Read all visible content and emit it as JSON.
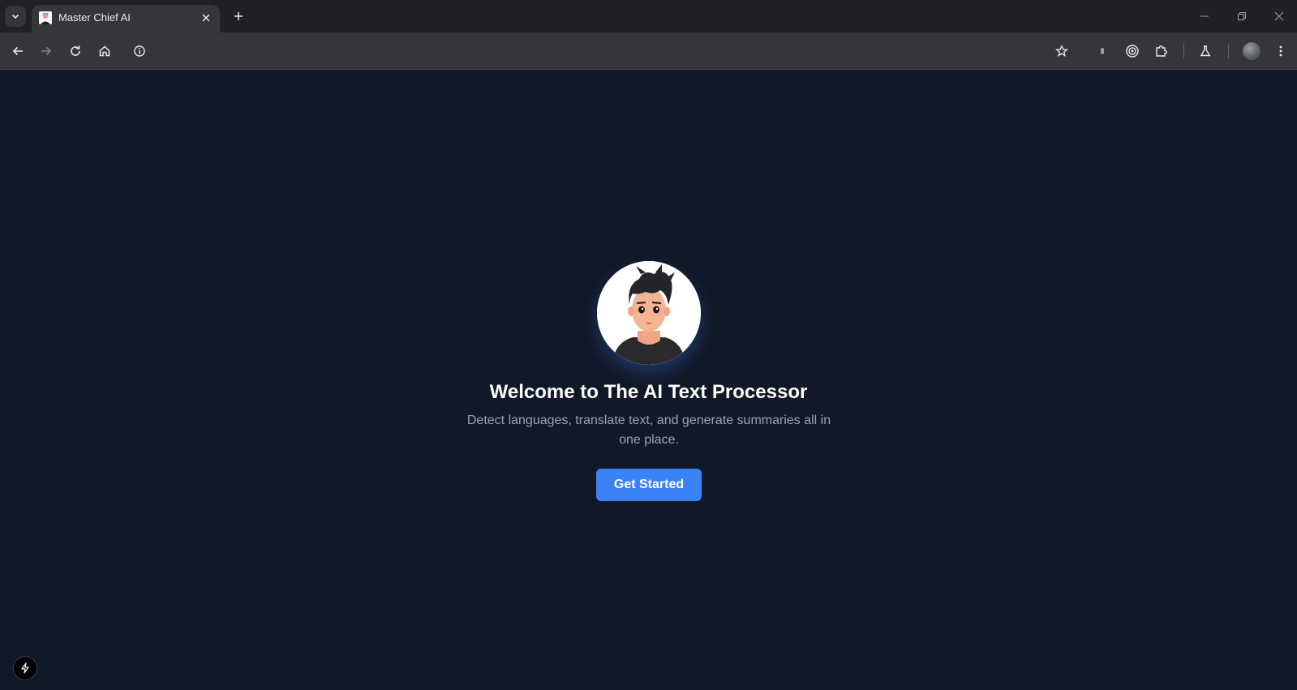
{
  "browser": {
    "tab": {
      "title": "Master Chief AI"
    },
    "icons": {
      "tab_search": "chevron-down-icon",
      "close_tab": "close-icon",
      "new_tab": "plus-icon",
      "back": "arrow-left-icon",
      "forward": "arrow-right-icon",
      "reload": "reload-icon",
      "home": "home-icon",
      "site_info": "info-icon",
      "bookmark": "star-icon",
      "extensions": "puzzle-icon",
      "labs": "flask-icon",
      "menu": "kebab-menu-icon"
    }
  },
  "page": {
    "title": "Welcome to The AI Text Processor",
    "subtitle": "Detect languages, translate text, and generate summaries all in one place.",
    "cta_label": "Get Started",
    "colors": {
      "background": "#111827",
      "accent": "#3b82f6",
      "subtitle": "#9ca3af"
    }
  },
  "dev_indicator": {
    "icon": "lightning-icon"
  }
}
